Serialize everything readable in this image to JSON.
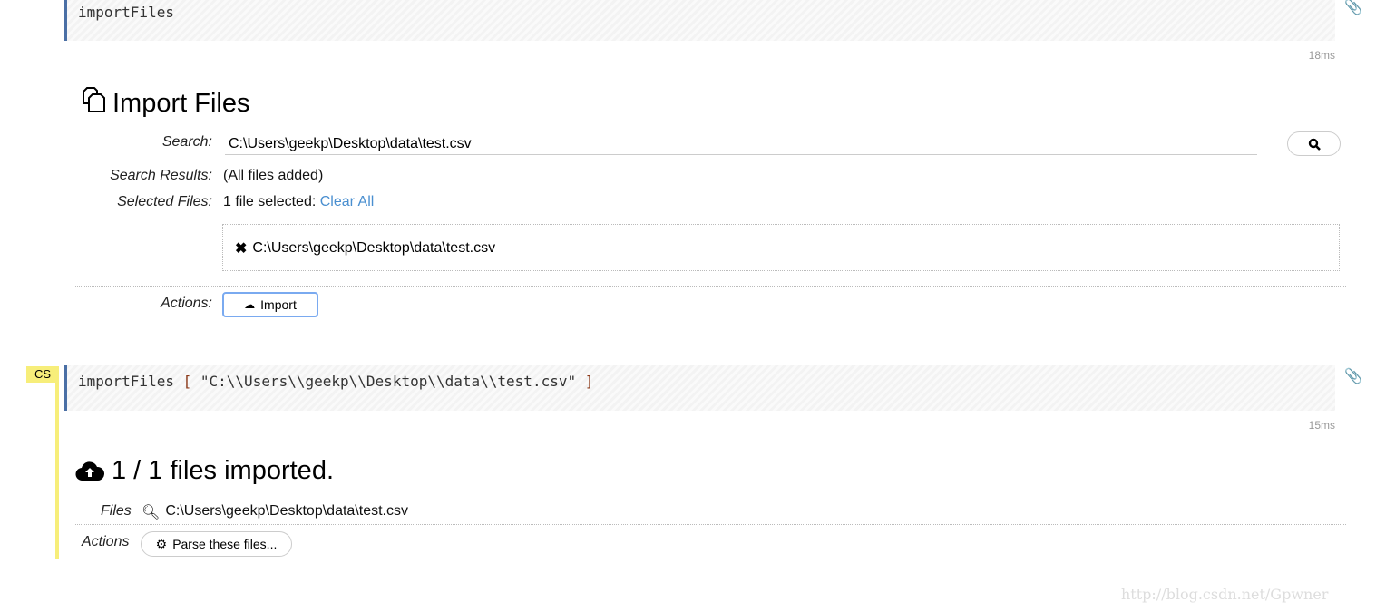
{
  "cell1": {
    "code": "importFiles",
    "timing": "18ms"
  },
  "import_panel": {
    "title": "Import Files",
    "search_label": "Search:",
    "search_value": "C:\\Users\\geekp\\Desktop\\data\\test.csv",
    "results_label": "Search Results:",
    "results_value": "(All files added)",
    "selected_label": "Selected Files:",
    "selected_value": "1 file selected:",
    "clear_all": "Clear All",
    "files": [
      "C:\\Users\\geekp\\Desktop\\data\\test.csv"
    ],
    "actions_label": "Actions:",
    "import_button": "Import"
  },
  "cell2": {
    "badge": "CS",
    "code_fn": "importFiles",
    "code_open": "[",
    "code_arg": "\"C:\\\\Users\\\\geekp\\\\Desktop\\\\data\\\\test.csv\"",
    "code_close": "]",
    "timing": "15ms"
  },
  "result": {
    "title": "1 / 1 files imported.",
    "files_label": "Files",
    "file": "C:\\Users\\geekp\\Desktop\\data\\test.csv",
    "actions_label": "Actions",
    "parse_button": "Parse these files..."
  },
  "watermark": "http://blog.csdn.net/Gpwner"
}
